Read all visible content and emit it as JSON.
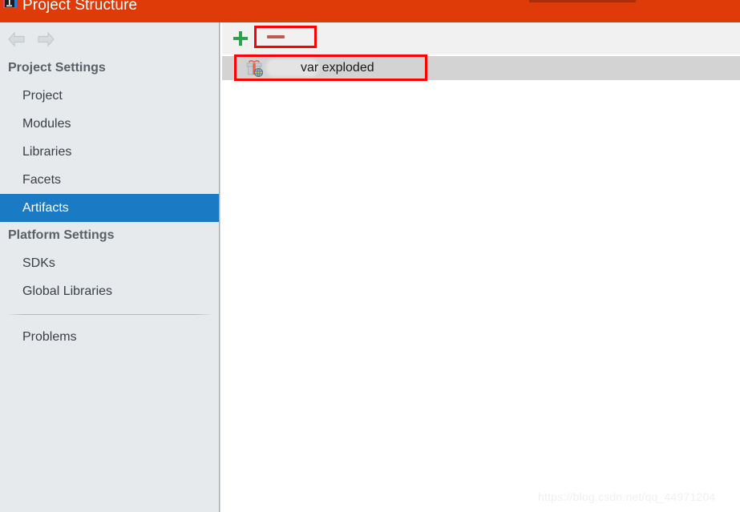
{
  "window": {
    "title": "Project Structure",
    "app_icon": "intellij-idea-icon",
    "titlebar_color": "#DE3B08"
  },
  "nav": {
    "back_icon": "arrow-left-icon",
    "forward_icon": "arrow-right-icon",
    "back_enabled": false,
    "forward_enabled": false
  },
  "sidebar": {
    "groups": [
      {
        "header": "Project Settings",
        "items": [
          {
            "label": "Project",
            "selected": false
          },
          {
            "label": "Modules",
            "selected": false
          },
          {
            "label": "Libraries",
            "selected": false
          },
          {
            "label": "Facets",
            "selected": false
          },
          {
            "label": "Artifacts",
            "selected": true
          }
        ]
      },
      {
        "header": "Platform Settings",
        "items": [
          {
            "label": "SDKs",
            "selected": false
          },
          {
            "label": "Global Libraries",
            "selected": false
          }
        ]
      }
    ],
    "problems_label": "Problems",
    "selected_color": "#1A7BC4",
    "background_color": "#E6EAED"
  },
  "toolbar": {
    "add_icon": "plus-icon",
    "add_color": "#2EA14C",
    "remove_icon": "minus-icon",
    "remove_color": "#C05A4D"
  },
  "artifacts": {
    "rows": [
      {
        "icon": "gift-web-artifact-icon",
        "label": "var exploded",
        "redacted": true,
        "selected": true
      }
    ],
    "row_selected_color": "#D3D3D3"
  },
  "annotations": {
    "color": "#FF0000",
    "highlight_remove_button": true,
    "highlight_artifact_row": true
  },
  "watermark": {
    "text": "https://blog.csdn.net/qq_44971204"
  }
}
